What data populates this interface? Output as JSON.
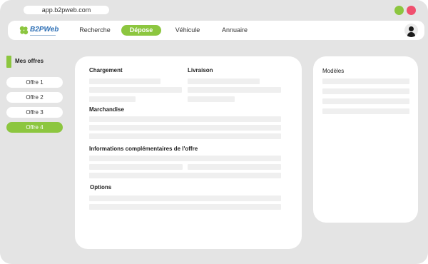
{
  "browser": {
    "url": "app.b2pweb.com"
  },
  "window_controls": [
    {
      "name": "window-green-button",
      "color": "#8cc63f"
    },
    {
      "name": "window-red-button",
      "color": "#f0506e"
    }
  ],
  "navbar": {
    "logo": "B2PWeb",
    "items": [
      "Recherche",
      "Dépose",
      "Véhicule",
      "Annuaire"
    ],
    "active_item": "Dépose",
    "user_icon": "user-icon"
  },
  "sidebar": {
    "title": "Mes offres",
    "offres": [
      "Offre 1",
      "Offre 2",
      "Offre 3",
      "Offre 4"
    ],
    "active_offre": "Offre 4"
  },
  "form": {
    "chargement": "Chargement",
    "livraison": "Livraison",
    "marchandise": "Marchandise",
    "informations": "Informations complémentaires de l'offre",
    "options": "Options"
  },
  "modeles": {
    "title": "Modèles"
  },
  "colors": {
    "accent": "#8cc63f",
    "brand_blue": "#2d6fb5",
    "close_red": "#f0506e",
    "window_bg": "#e4e4e4",
    "placeholder": "#efefef"
  }
}
